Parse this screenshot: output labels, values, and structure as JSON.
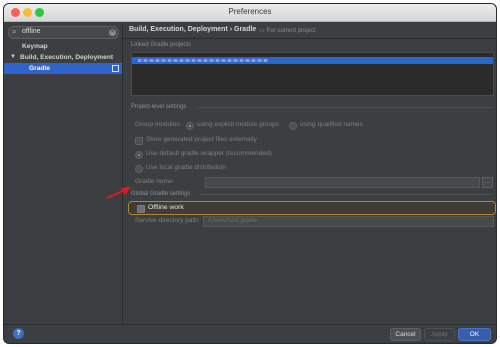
{
  "window": {
    "title": "Preferences"
  },
  "sidebar": {
    "search_value": "offline",
    "items": [
      {
        "label": "Keymap"
      },
      {
        "label": "Build, Execution, Deployment",
        "arrow": "▼"
      },
      {
        "label": "Gradle"
      }
    ]
  },
  "breadcrumb": {
    "path": "Build, Execution, Deployment  ›  Gradle",
    "scope": "For current project"
  },
  "linked": {
    "header": "Linked Gradle projects"
  },
  "project_settings": {
    "header": "Project-level settings",
    "group_modules_label": "Group modules:",
    "opt_explicit": "using explicit module groups",
    "opt_qualified": "using qualified names",
    "store_external": "Store generated project files externally",
    "default_wrapper": "Use default gradle wrapper (recommended)",
    "local_distribution": "Use local gradle distribution",
    "gradle_home_label": "Gradle home:"
  },
  "global_settings": {
    "header": "Global Gradle settings",
    "offline_work": "Offline work",
    "service_dir_label": "Service directory path:",
    "service_dir_value": "/Users/tom/.gradle"
  },
  "footer": {
    "help": "?",
    "cancel": "Cancel",
    "apply": "Apply",
    "ok": "OK"
  },
  "colors": {
    "accent": "#2f65ca",
    "highlight": "#b3862f",
    "annotation_arrow": "#e01b1b"
  },
  "icons": [
    "search-icon",
    "clear-icon",
    "copy-icon",
    "scope-icon",
    "folder-icon",
    "help-icon",
    "annotation-arrow"
  ]
}
